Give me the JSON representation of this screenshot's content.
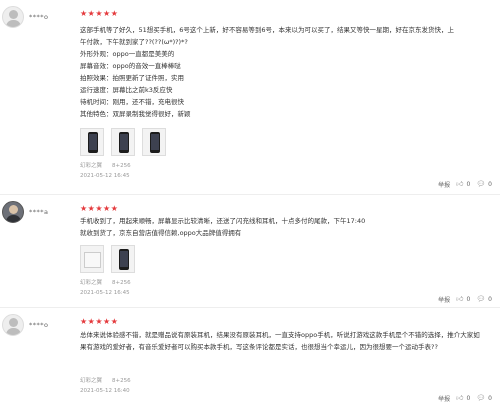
{
  "reviews": [
    {
      "username": "****o",
      "stars": "★★★★★",
      "lines": [
        "这部手机等了好久，51想买手机，6号这个上新，好不容易等到6号，本来以为可以买了，结果又等快一星期，好在京东发货快，上",
        "午付款，下午就到家了??(??(ω*)?)*?",
        "外形外观：oppo一直都是美美的",
        "屏幕音效：oppo的音效一直棒棒哒",
        "拍照效果：拍照更新了证件照，实用",
        "运行速度：屏幕比之前k3反应快",
        "待机时间：刚用，还不错，充电很快",
        "其他特色：双屏录制我觉得很好，新颖"
      ],
      "product": "幻彩之翼",
      "spec": "8+256",
      "date": "2021-05-12 16:45",
      "report": "举报",
      "likes": "0",
      "replies": "0"
    },
    {
      "username": "****a",
      "stars": "★★★★★",
      "lines": [
        "手机收到了，用起来顺畅，屏幕显示比较清晰，还送了闪充线和耳机，十点多付的尾款，下午17:40",
        "就收到货了，京东自营店值得信赖,oppo大品牌值得拥有"
      ],
      "product": "幻彩之翼",
      "spec": "8+256",
      "date": "2021-05-12 16:45",
      "report": "举报",
      "likes": "0",
      "replies": "0"
    },
    {
      "username": "****o",
      "stars": "★★★★★",
      "lines": [
        "总体来说体验感不错，就是赠品说有原装耳机，结果没有原装耳机，一直支持oppo手机，听说打游戏这款手机是个不错的选择，推介大家如果有游戏的爱好者，有音乐爱好者可以购买本款手机，写这条评论都是实话，也很想当个幸运儿，因为很想要一个运动手表??"
      ],
      "product": "幻彩之翼",
      "spec": "8+256",
      "date": "2021-05-12 16:40",
      "report": "举报",
      "likes": "0",
      "replies": "0"
    }
  ]
}
